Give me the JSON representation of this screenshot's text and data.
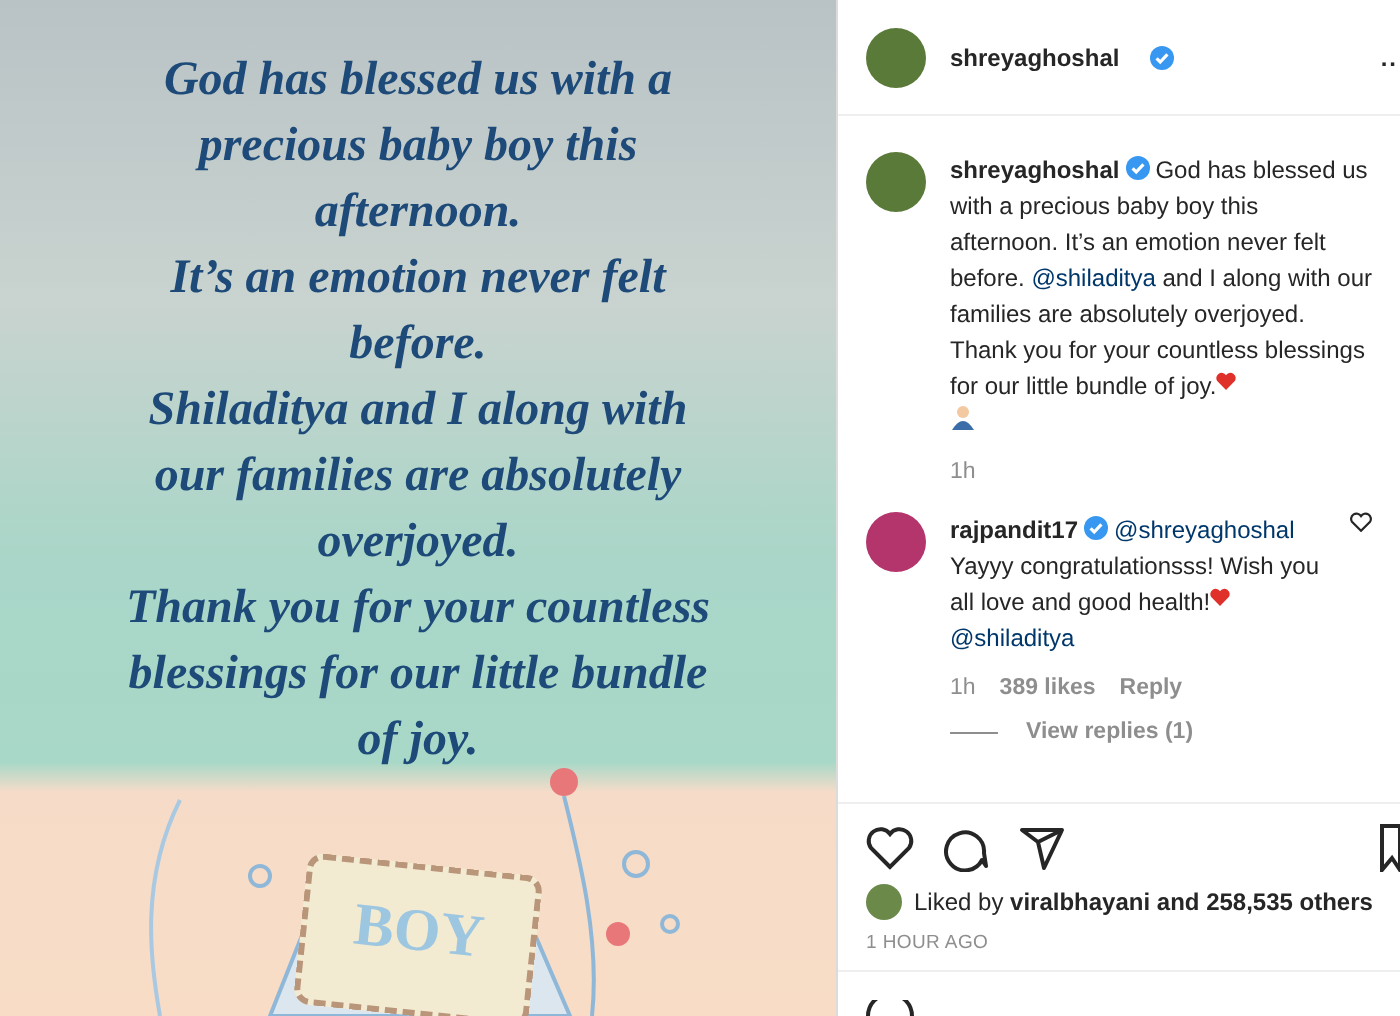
{
  "post_image": {
    "lines": [
      "God has blessed us with a",
      "precious baby boy this",
      "afternoon.",
      "It’s an emotion never felt",
      "before.",
      "Shiladitya and I along with",
      "our families are absolutely",
      "overjoyed.",
      "Thank you for your countless",
      "blessings for our little bundle",
      "of joy."
    ],
    "card_text": "BOY"
  },
  "header": {
    "username": "shreyaghoshal",
    "verified": true,
    "more": ".."
  },
  "caption": {
    "username": "shreyaghoshal",
    "verified": true,
    "text_before": "God has blessed us with a precious baby boy this afternoon. It’s an emotion never felt before. ",
    "mention": "@shiladitya",
    "text_after": " and I along with our families are absolutely overjoyed. Thank you for your countless blessings for our little bundle of joy.",
    "time": "1h"
  },
  "comments": [
    {
      "username": "rajpandit17",
      "verified": true,
      "mention": "@shreyaghoshal",
      "text": "Yayyy congratulationsss! Wish you all love and good health!",
      "mention_after": "@shiladitya",
      "time": "1h",
      "likes": "389 likes",
      "reply": "Reply",
      "view_replies": "View replies (1)",
      "liked": false
    }
  ],
  "actions": {
    "liked": false
  },
  "likes": {
    "text": "Liked by ",
    "user": "viralbhayani",
    "rest": " and 258,535 others"
  },
  "timestamp": "1 HOUR AGO"
}
